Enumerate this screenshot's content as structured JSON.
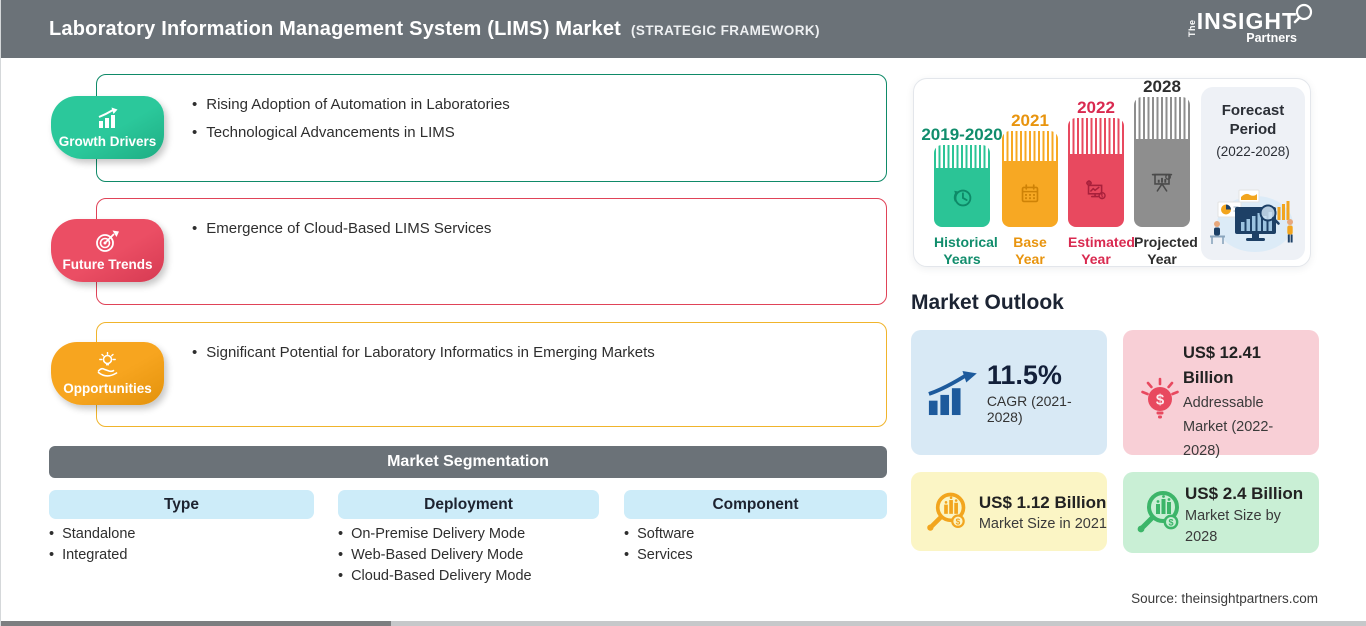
{
  "header": {
    "title": "Laboratory Information Management System (LIMS) Market",
    "subtitle": "(STRATEGIC FRAMEWORK)",
    "logo": {
      "the": "The",
      "insight": "INSIGHT",
      "partners": "Partners"
    }
  },
  "colors": {
    "header_bg": "#6B7278",
    "growth_green": "#2BC496",
    "trends_red": "#E8495F",
    "opportunities_orange": "#F5A11E",
    "base_year_orange": "#F7A823",
    "projected_gray": "#8E8E8E",
    "segment_header_blue": "#CDECF9",
    "card_blue_bg": "#D8E9F5",
    "card_blue_icon": "#1D5A9C",
    "card_pink_bg": "#F8CFD6",
    "card_pink_icon": "#E8495F",
    "card_yellow_bg": "#FBF5C5",
    "card_yellow_icon": "#F2A51E",
    "card_green_bg": "#C9EFD5",
    "card_green_icon": "#3CB569"
  },
  "framework_sections": [
    {
      "label": "Growth Drivers",
      "icon": "growth-chart-icon",
      "points": [
        "Rising Adoption of Automation in Laboratories",
        "Technological Advancements in LIMS"
      ]
    },
    {
      "label": "Future Trends",
      "icon": "target-dart-icon",
      "points": [
        "Emergence of Cloud-Based LIMS Services"
      ]
    },
    {
      "label": "Opportunities",
      "icon": "idea-hand-icon",
      "points": [
        "Significant Potential for Laboratory Informatics in Emerging Markets"
      ]
    }
  ],
  "segmentation": {
    "title": "Market Segmentation",
    "columns": [
      {
        "header": "Type",
        "items": [
          "Standalone",
          "Integrated"
        ]
      },
      {
        "header": "Deployment",
        "items": [
          "On-Premise Delivery Mode",
          "Web-Based Delivery Mode",
          "Cloud-Based Delivery Mode"
        ]
      },
      {
        "header": "Component",
        "items": [
          "Software",
          "Services"
        ]
      }
    ]
  },
  "timeline": {
    "bars": [
      {
        "year": "2019-2020",
        "label": "Historical Years",
        "label_line1": "Historical",
        "label_line2": "Years",
        "icon": "history-clock-icon"
      },
      {
        "year": "2021",
        "label": "Base Year",
        "label_line1": "Base",
        "label_line2": "Year",
        "icon": "calendar-icon"
      },
      {
        "year": "2022",
        "label": "Estimated Year",
        "label_line1": "Estimated",
        "label_line2": "Year",
        "icon": "monitor-analytics-icon"
      },
      {
        "year": "2028",
        "label": "Projected Year",
        "label_line1": "Projected",
        "label_line2": "Year",
        "icon": "projection-screen-icon"
      }
    ],
    "forecast_period": {
      "line1": "Forecast",
      "line2": "Period",
      "range": "(2022-2028)"
    }
  },
  "outlook": {
    "title": "Market Outlook",
    "cards": [
      {
        "value": "11.5%",
        "desc": "CAGR (2021-2028)",
        "icon": "growth-bars-arrow-icon"
      },
      {
        "value": "US$ 12.41 Billion",
        "desc": "Addressable Market (2022-2028)",
        "icon": "bulb-dollar-icon"
      },
      {
        "value": "US$ 1.12 Billion",
        "desc": "Market Size in 2021",
        "icon": "magnifier-chart-icon"
      },
      {
        "value": "US$ 2.4 Billion",
        "desc": "Market Size by 2028",
        "icon": "magnifier-chart-icon"
      }
    ]
  },
  "source": "Source: theinsightpartners.com"
}
